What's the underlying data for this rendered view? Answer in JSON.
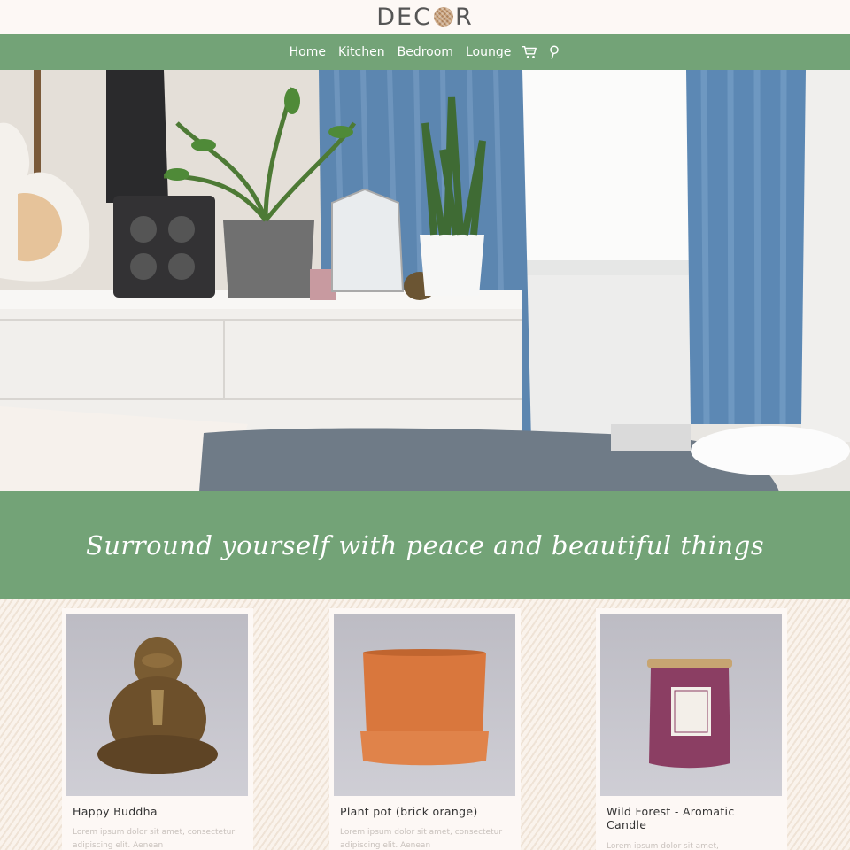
{
  "brand": {
    "logo_text_left": "DEC",
    "logo_text_right": "R"
  },
  "nav": {
    "items": [
      {
        "label": "Home"
      },
      {
        "label": "Kitchen"
      },
      {
        "label": "Bedroom"
      },
      {
        "label": "Lounge"
      }
    ],
    "cart_icon": "cart-icon",
    "search_icon": "search-icon"
  },
  "tagline": "Surround yourself with peace and beautiful things",
  "products": [
    {
      "name": "Happy Buddha",
      "desc": "Lorem ipsum dolor sit amet, consectetur adipiscing elit. Aenean",
      "image": "buddha-figurine"
    },
    {
      "name": "Plant pot (brick orange)",
      "desc": "Lorem ipsum dolor sit amet, consectetur adipiscing elit. Aenean",
      "image": "terracotta-pot"
    },
    {
      "name": "Wild Forest - Aromatic Candle",
      "desc": "Lorem ipsum dolor sit amet,",
      "image": "scented-candle"
    }
  ],
  "colors": {
    "accent": "#73a377",
    "background": "#fdf8f5",
    "text": "#333333"
  }
}
